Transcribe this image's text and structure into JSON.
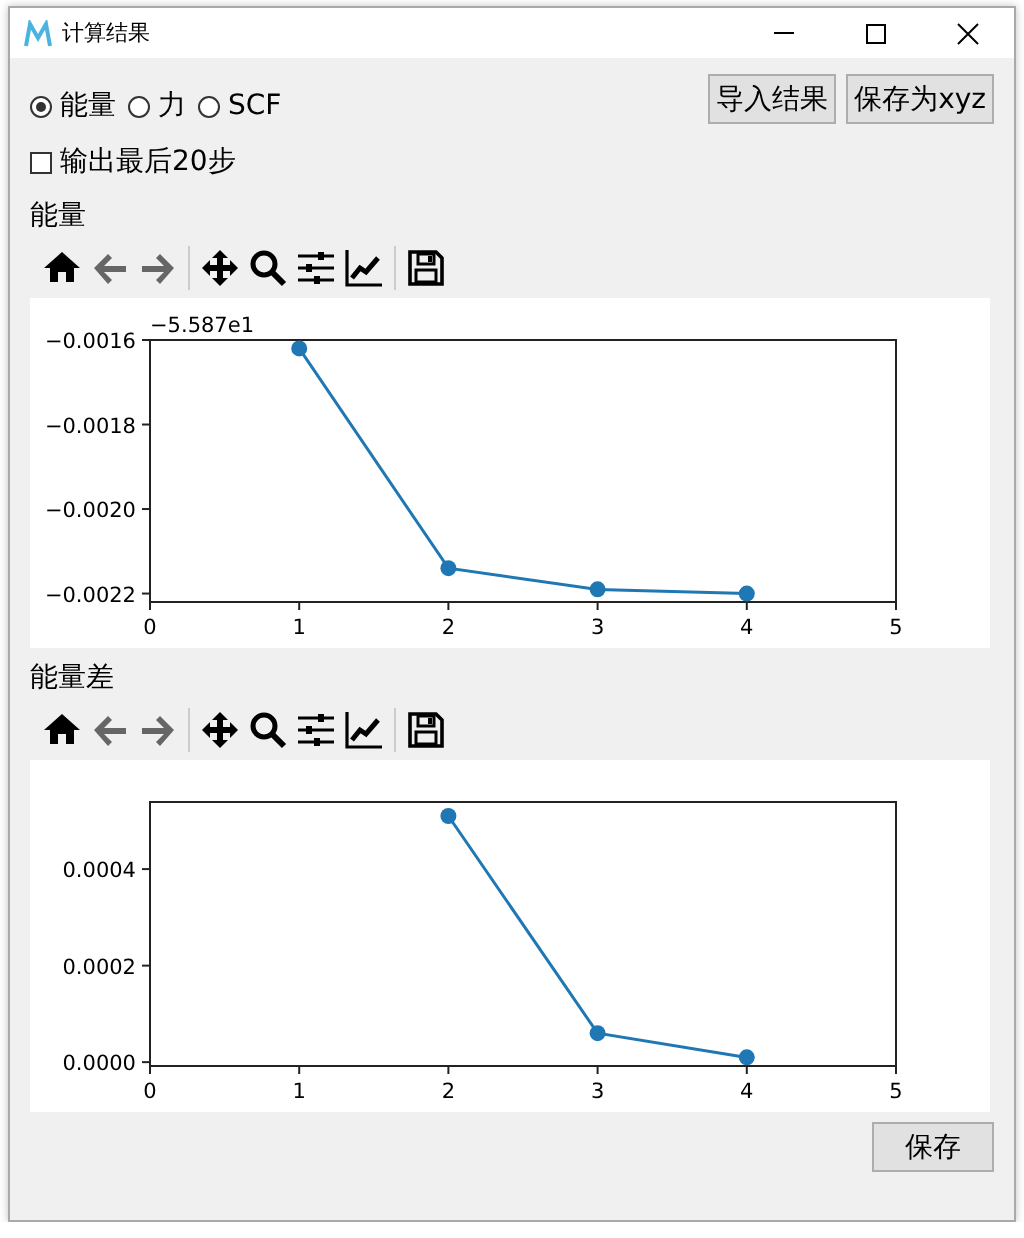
{
  "window": {
    "title": "计算结果"
  },
  "mode_options": [
    {
      "label": "能量",
      "selected": true
    },
    {
      "label": "力",
      "selected": false
    },
    {
      "label": "SCF",
      "selected": false
    }
  ],
  "top_buttons": [
    "导入结果",
    "保存为xyz"
  ],
  "last_steps_checkbox": {
    "label": "输出最后20步",
    "checked": false
  },
  "panels": [
    {
      "title": "能量",
      "chart_data": {
        "type": "line",
        "x": [
          1,
          2,
          3,
          4
        ],
        "series": [
          {
            "color": "#1f77b4",
            "marker": "o",
            "values": [
              -0.00162,
              -0.00214,
              -0.00219,
              -0.0022
            ]
          }
        ],
        "xlim": [
          0,
          5
        ],
        "ylim": [
          -0.00222,
          -0.0016
        ],
        "xticks": [
          0,
          1,
          2,
          3,
          4,
          5
        ],
        "yticks": [
          {
            "value": -0.0016,
            "label": "−0.0016"
          },
          {
            "value": -0.0018,
            "label": "−0.0018"
          },
          {
            "value": -0.002,
            "label": "−0.0020"
          },
          {
            "value": -0.0022,
            "label": "−0.0022"
          }
        ],
        "annotations": [
          {
            "text": "−5.587e1"
          }
        ]
      }
    },
    {
      "title": "能量差",
      "chart_data": {
        "type": "line",
        "x": [
          2,
          3,
          4
        ],
        "series": [
          {
            "color": "#1f77b4",
            "marker": "o",
            "values": [
              0.00051,
              6e-05,
              1e-05
            ]
          }
        ],
        "xlim": [
          0,
          5
        ],
        "ylim": [
          -8e-06,
          0.000539
        ],
        "xticks": [
          0,
          1,
          2,
          3,
          4,
          5
        ],
        "yticks": [
          {
            "value": 0,
            "label": "0.0000"
          },
          {
            "value": 0.0002,
            "label": "0.0002"
          },
          {
            "value": 0.0004,
            "label": "0.0004"
          }
        ]
      }
    }
  ],
  "save_button": "保存"
}
